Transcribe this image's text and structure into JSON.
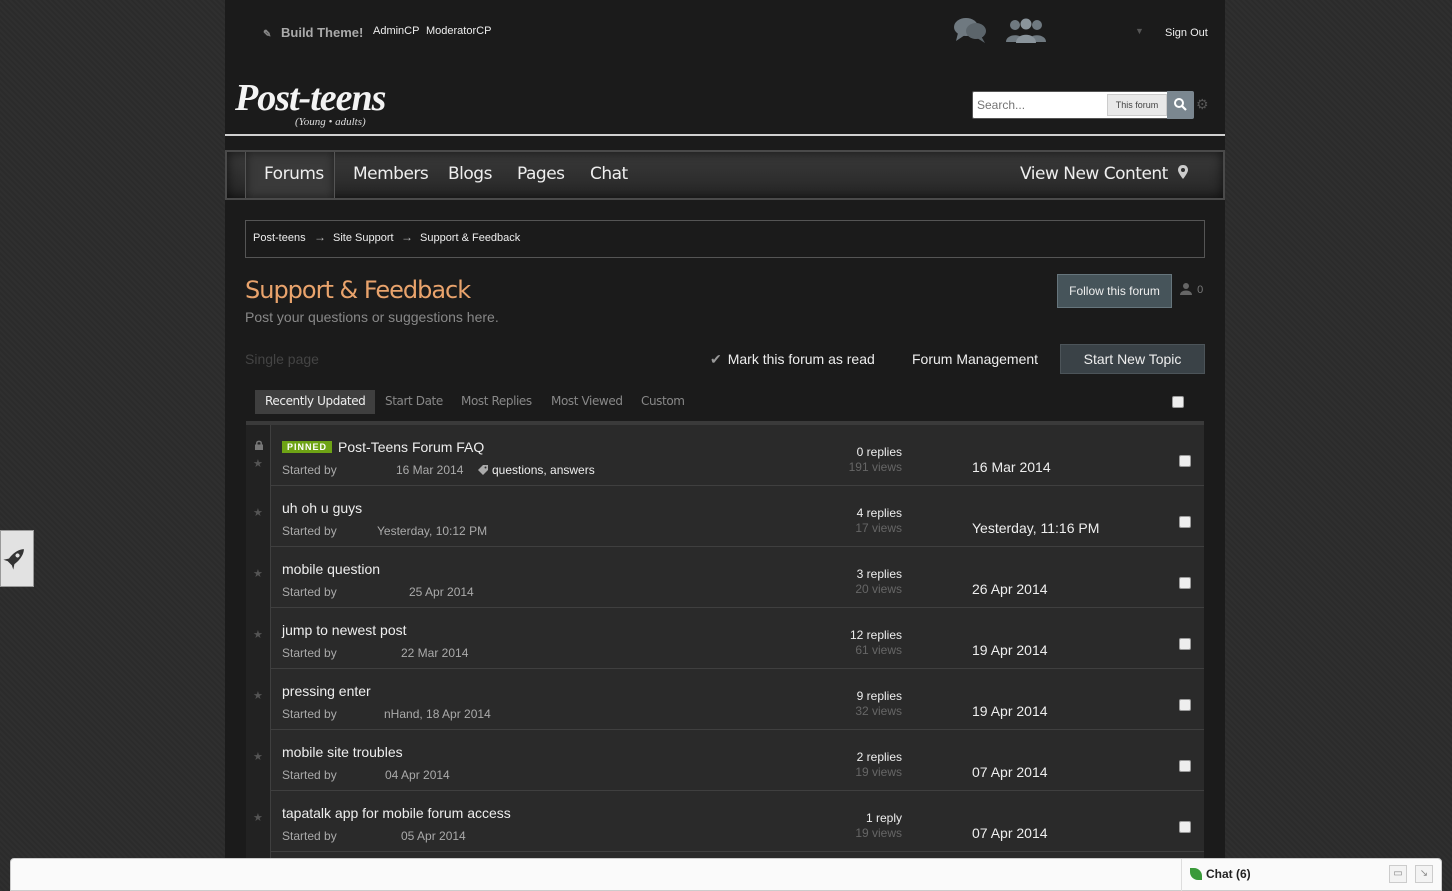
{
  "topbar": {
    "build_theme": "Build Theme!",
    "admincp": "AdminCP",
    "moderatorcp": "ModeratorCP",
    "signout": "Sign Out"
  },
  "logo": {
    "main": "Post-teens",
    "sub": "(Young • adults)"
  },
  "search": {
    "placeholder": "Search...",
    "scope": "This forum"
  },
  "nav": {
    "items": [
      "Forums",
      "Members",
      "Blogs",
      "Pages",
      "Chat"
    ],
    "view_new": "View New Content"
  },
  "breadcrumb": [
    "Post-teens",
    "Site Support",
    "Support & Feedback"
  ],
  "breadcrumb_sep": "→",
  "forum": {
    "title": "Support & Feedback",
    "description": "Post your questions or suggestions here.",
    "follow_label": "Follow this forum",
    "follow_count": "0",
    "pagination": "Single page",
    "mark_read": "Mark this forum as read",
    "management": "Forum Management",
    "start_new": "Start New Topic"
  },
  "sort_tabs": [
    "Recently Updated",
    "Start Date",
    "Most Replies",
    "Most Viewed",
    "Custom"
  ],
  "topics": [
    {
      "pinned_label": "PINNED",
      "title": "Post-Teens Forum FAQ",
      "started_by": "Started by",
      "date": "16 Mar 2014",
      "tags": "questions, answers",
      "replies": "0 replies",
      "views": "191 views",
      "last": "16 Mar 2014"
    },
    {
      "title": "uh oh u guys",
      "started_by": "Started by",
      "date": "Yesterday, 10:12 PM",
      "replies": "4 replies",
      "views": "17 views",
      "last": "Yesterday, 11:16 PM"
    },
    {
      "title": "mobile question",
      "started_by": "Started by",
      "date": "25 Apr 2014",
      "replies": "3 replies",
      "views": "20 views",
      "last": "26 Apr 2014"
    },
    {
      "title": "jump to newest post",
      "started_by": "Started by",
      "date": "22 Mar 2014",
      "replies": "12 replies",
      "views": "61 views",
      "last": "19 Apr 2014"
    },
    {
      "title": "pressing enter",
      "started_by": "Started by",
      "date": "nHand, 18 Apr 2014",
      "replies": "9 replies",
      "views": "32 views",
      "last": "19 Apr 2014"
    },
    {
      "title": "mobile site troubles",
      "started_by": "Started by",
      "date": "04 Apr 2014",
      "replies": "2 replies",
      "views": "19 views",
      "last": "07 Apr 2014"
    },
    {
      "title": "tapatalk app for mobile forum access",
      "started_by": "Started by",
      "date": "05 Apr 2014",
      "replies": "1 reply",
      "views": "19 views",
      "last": "07 Apr 2014"
    }
  ],
  "chatbar": {
    "label": "Chat",
    "count": "(6)"
  }
}
